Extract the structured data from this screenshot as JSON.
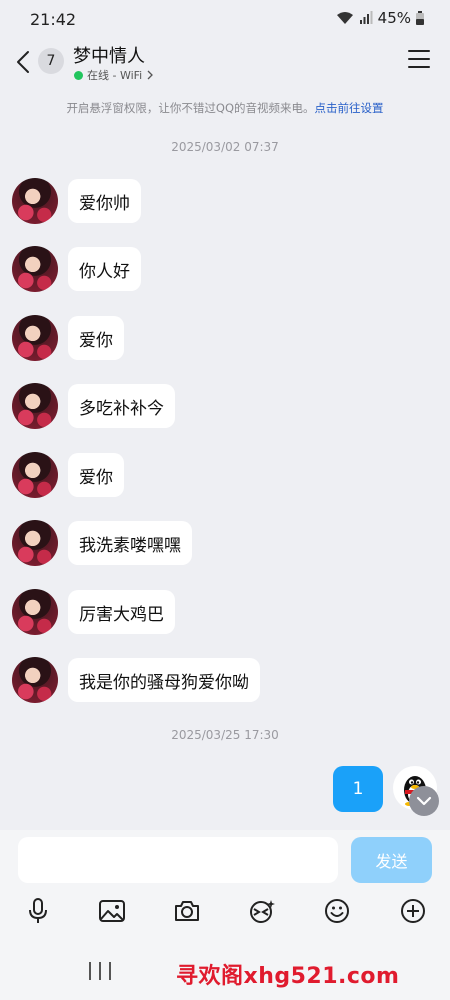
{
  "status_bar": {
    "time": "21:42",
    "battery": "45%"
  },
  "header": {
    "unread_count": "7",
    "contact_name": "梦中情人",
    "presence": "在线 - WiFi",
    "presence_color": "#22c55e"
  },
  "notice": {
    "text": "开启悬浮窗权限，让你不错过QQ的音视频来电。",
    "link": "点击前往设置"
  },
  "timestamps": [
    "2025/03/02 07:37",
    "2025/03/25 17:30"
  ],
  "incoming_messages": [
    {
      "text": "爱你帅"
    },
    {
      "text": "你人好"
    },
    {
      "text": "爱你"
    },
    {
      "text": "多吃补补今"
    },
    {
      "text": "爱你"
    },
    {
      "text": "我洗素喽嘿嘿"
    },
    {
      "text": "厉害大鸡巴"
    },
    {
      "text": "我是你的骚母狗爱你呦"
    }
  ],
  "outgoing_messages": [
    {
      "text": "1"
    }
  ],
  "composer": {
    "input_value": "",
    "send_label": "发送"
  },
  "toolbar": {
    "items": [
      "microphone-icon",
      "image-icon",
      "camera-icon",
      "sticker-icon",
      "emoji-icon",
      "plus-icon"
    ]
  },
  "watermark": "寻欢阁xhg521.com",
  "colors": {
    "accent": "#1aa1f9",
    "send_disabled": "#8fd0fb",
    "background": "#eeeff3",
    "watermark": "#e01b2e"
  }
}
